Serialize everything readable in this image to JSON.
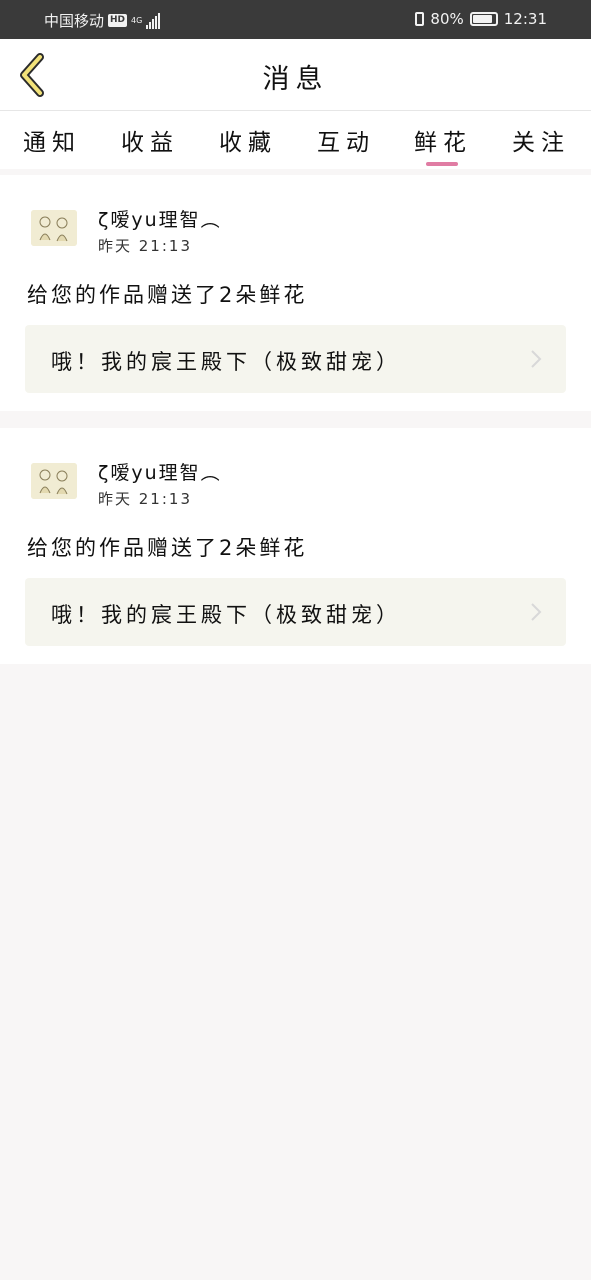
{
  "status_bar": {
    "carrier": "中国移动",
    "hd": "HD",
    "network": "4G",
    "battery": "80%",
    "time": "12:31"
  },
  "nav": {
    "title": "消息",
    "back_icon": "chevron-left-icon"
  },
  "tabs": [
    {
      "label": "通知"
    },
    {
      "label": "收益"
    },
    {
      "label": "收藏"
    },
    {
      "label": "互动"
    },
    {
      "label": "鲜花",
      "active": true
    },
    {
      "label": "关注"
    }
  ],
  "colors": {
    "accent": "#e07ca3",
    "status_bar_bg": "#3a3a3a",
    "link_card_bg": "#f5f5ee",
    "page_bg": "#f8f6f6"
  },
  "messages": [
    {
      "username": "ζ嗳yu理智︵",
      "time": "昨天 21:13",
      "text": "给您的作品赠送了2朵鲜花",
      "work_title": "哦！我的宸王殿下（极致甜宠）"
    },
    {
      "username": "ζ嗳yu理智︵",
      "time": "昨天 21:13",
      "text": "给您的作品赠送了2朵鲜花",
      "work_title": "哦！我的宸王殿下（极致甜宠）"
    }
  ]
}
